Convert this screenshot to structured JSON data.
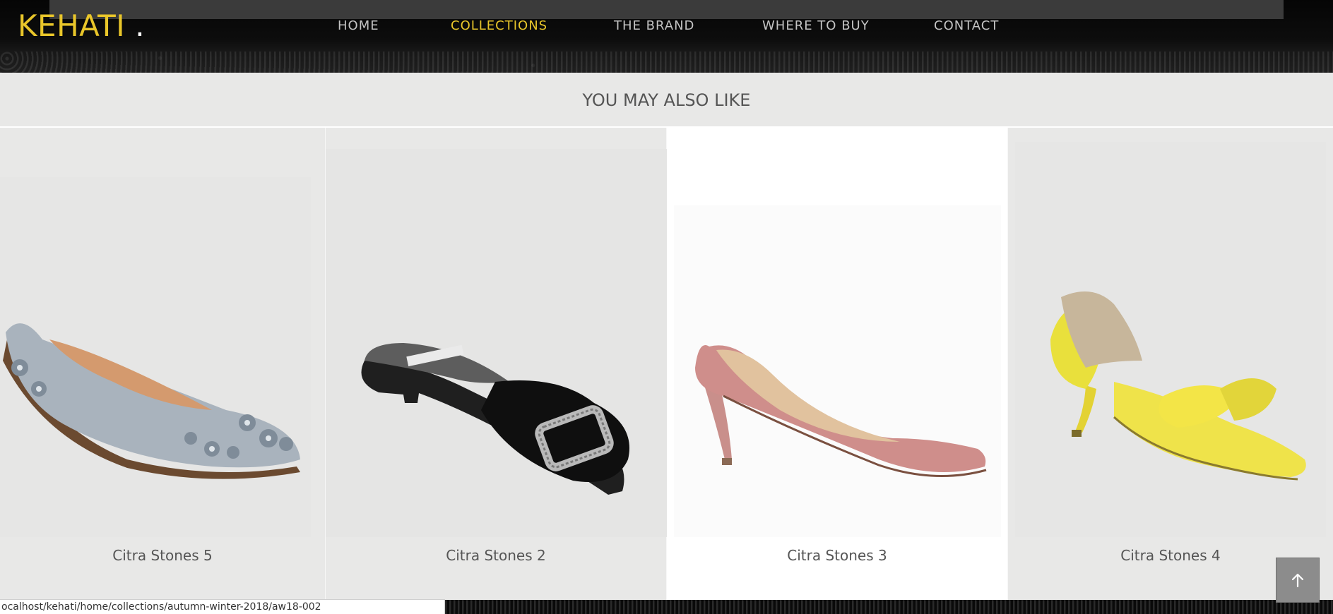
{
  "brand": {
    "name": "KEHATI",
    "dot": "."
  },
  "nav": {
    "items": [
      {
        "label": "HOME",
        "active": false
      },
      {
        "label": "COLLECTIONS",
        "active": true
      },
      {
        "label": "THE BRAND",
        "active": false
      },
      {
        "label": "WHERE TO BUY",
        "active": false
      },
      {
        "label": "CONTACT",
        "active": false
      }
    ]
  },
  "section": {
    "title": "YOU MAY ALSO LIKE"
  },
  "products": [
    {
      "name": "Citra Stones 5",
      "image": "silver-floral-flat-shoe"
    },
    {
      "name": "Citra Stones 2",
      "image": "black-jeweled-mule"
    },
    {
      "name": "Citra Stones 3",
      "image": "pink-suede-pump"
    },
    {
      "name": "Citra Stones 4",
      "image": "yellow-bow-dorsay-heel"
    }
  ],
  "status": {
    "url": "ocalhost/kehati/home/collections/autumn-winter-2018/aw18-002"
  },
  "scroll_top": {
    "icon": "arrow-up-icon"
  },
  "colors": {
    "accent": "#e9c62a",
    "header_bg": "#0b0b0b",
    "page_bg": "#e8e8e7"
  }
}
